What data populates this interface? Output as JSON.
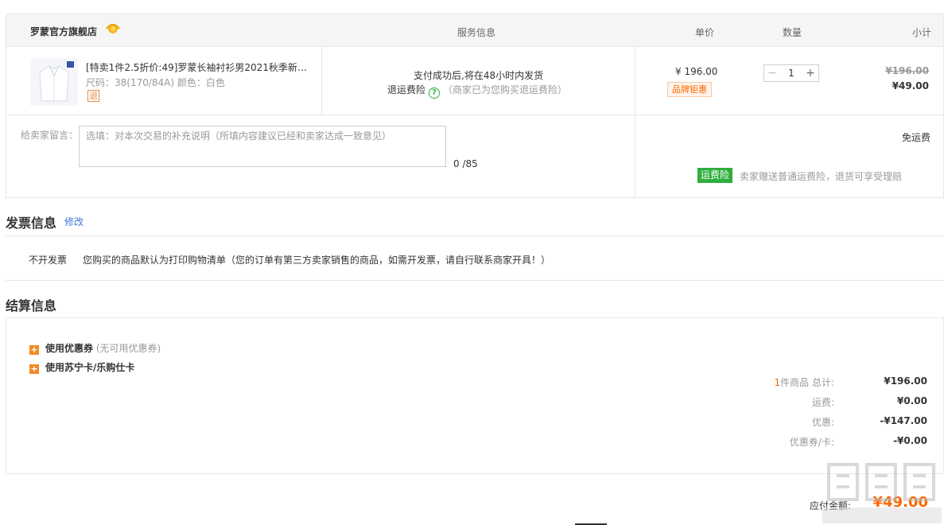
{
  "order": {
    "shop_name": "罗蒙官方旗舰店",
    "headers": {
      "service": "服务信息",
      "price": "单价",
      "quantity": "数量",
      "subtotal": "小计"
    },
    "item": {
      "title": "[特卖1件2.5折价:49]罗蒙长袖衬衫男2021秋季新款...",
      "spec": "尺码：38(170/84A)   颜色：白色",
      "return_tag": "退",
      "service_line": "支付成功后,将在48小时内发货",
      "insurance_label": "退运费险",
      "insurance_note": "（商家已为您购买退运费险）",
      "unit_price": "¥ 196.00",
      "brand_tag": "品牌钜惠",
      "quantity": "1",
      "original_total": "¥196.00",
      "subtotal": "¥49.00"
    },
    "message": {
      "label": "给卖家留言：",
      "placeholder": "选填：对本次交易的补充说明（所填内容建议已经和卖家达成一致意见）",
      "value": "",
      "count": "0 /85"
    },
    "shipping": {
      "free": "免运费",
      "insurance_badge": "运费险",
      "insurance_note": "卖家赠送普通运费险，退货可享受理赔"
    }
  },
  "invoice": {
    "title": "发票信息",
    "edit_link": "修改",
    "type": "不开发票",
    "note": "您购买的商品默认为打印购物清单（您的订单有第三方卖家销售的商品，如需开发票，请自行联系商家开具！）"
  },
  "settlement": {
    "title": "结算信息",
    "coupon_label": "使用优惠券",
    "coupon_note": "(无可用优惠券)",
    "card_label": "使用苏宁卡/乐购仕卡",
    "item_count": "1",
    "total_label": "件商品 总计:",
    "total_value": "¥196.00",
    "shipping_label": "运费:",
    "shipping_value": "¥0.00",
    "discount_label": "优惠:",
    "discount_value": "-¥147.00",
    "coupon_card_label": "优惠券/卡:",
    "coupon_card_value": "-¥0.00",
    "payable_label": "应付金额:",
    "payable_value": "¥49.00"
  },
  "colors": {
    "accent": "#ff6600",
    "green": "#2fae3c",
    "link": "#3a7bd5"
  },
  "icons": {
    "shop_badge": "sun-badge-icon",
    "help": "question-icon",
    "expand": "plus-square-icon"
  }
}
